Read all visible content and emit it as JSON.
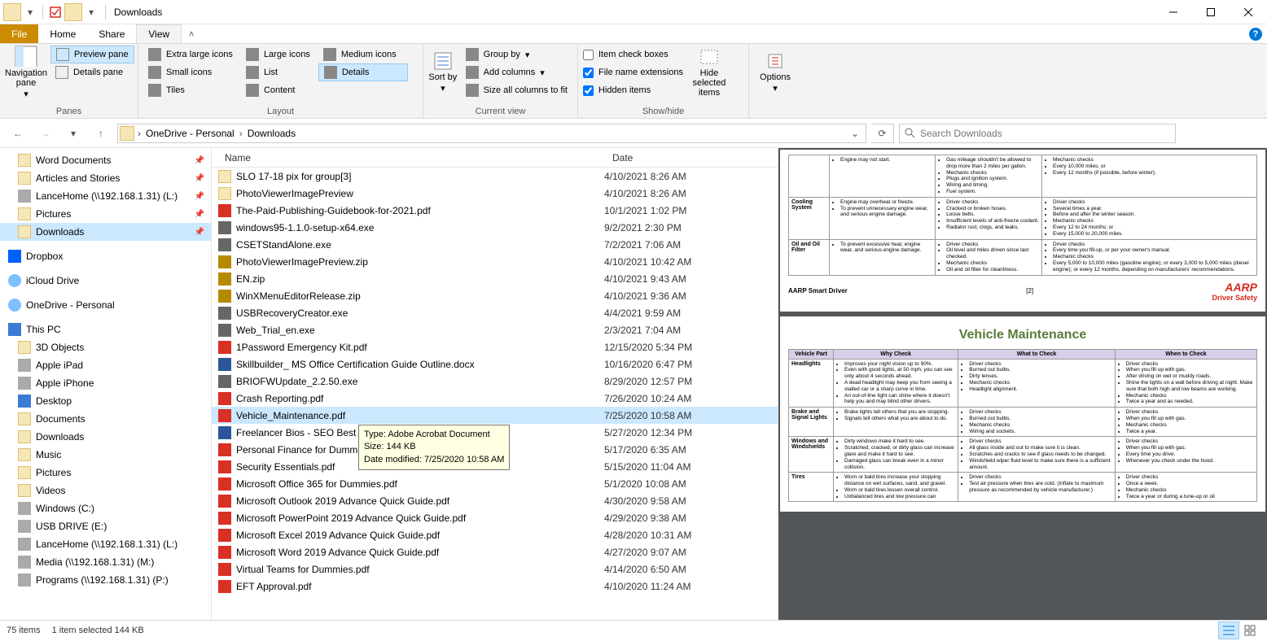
{
  "window": {
    "title": "Downloads"
  },
  "tabs": {
    "file": "File",
    "home": "Home",
    "share": "Share",
    "view": "View"
  },
  "ribbon": {
    "panes": {
      "label": "Panes",
      "nav": "Navigation pane",
      "preview": "Preview pane",
      "details": "Details pane"
    },
    "layout": {
      "label": "Layout",
      "xlarge": "Extra large icons",
      "large": "Large icons",
      "medium": "Medium icons",
      "small": "Small icons",
      "list": "List",
      "details": "Details",
      "tiles": "Tiles",
      "content": "Content"
    },
    "currentview": {
      "label": "Current view",
      "sortby": "Sort by",
      "groupby": "Group by",
      "addcols": "Add columns",
      "sizecols": "Size all columns to fit"
    },
    "showhide": {
      "label": "Show/hide",
      "itemcheck": "Item check boxes",
      "ext": "File name extensions",
      "hidden": "Hidden items",
      "hidesel": "Hide selected items"
    },
    "options": "Options"
  },
  "breadcrumb": {
    "seg1": "OneDrive - Personal",
    "seg2": "Downloads"
  },
  "search": {
    "placeholder": "Search Downloads"
  },
  "nav": {
    "items": [
      {
        "label": "Word Documents",
        "pin": true,
        "icon": "folder"
      },
      {
        "label": "Articles and Stories",
        "pin": true,
        "icon": "folder"
      },
      {
        "label": "LanceHome (\\\\192.168.1.31) (L:)",
        "pin": true,
        "icon": "disk"
      },
      {
        "label": "Pictures",
        "pin": true,
        "icon": "folder"
      },
      {
        "label": "Downloads",
        "pin": true,
        "icon": "folder",
        "selected": true
      },
      {
        "label": "",
        "spacer": true
      },
      {
        "label": "Dropbox",
        "icon": "dropbox",
        "section": true
      },
      {
        "label": "",
        "spacer": true
      },
      {
        "label": "iCloud Drive",
        "icon": "cloud",
        "section": true
      },
      {
        "label": "",
        "spacer": true
      },
      {
        "label": "OneDrive - Personal",
        "icon": "cloud",
        "section": true
      },
      {
        "label": "",
        "spacer": true
      },
      {
        "label": "This PC",
        "icon": "pc",
        "section": true
      },
      {
        "label": "3D Objects",
        "icon": "folder"
      },
      {
        "label": "Apple iPad",
        "icon": "disk"
      },
      {
        "label": "Apple iPhone",
        "icon": "disk"
      },
      {
        "label": "Desktop",
        "icon": "pc"
      },
      {
        "label": "Documents",
        "icon": "folder"
      },
      {
        "label": "Downloads",
        "icon": "folder"
      },
      {
        "label": "Music",
        "icon": "folder"
      },
      {
        "label": "Pictures",
        "icon": "folder"
      },
      {
        "label": "Videos",
        "icon": "folder"
      },
      {
        "label": "Windows (C:)",
        "icon": "disk"
      },
      {
        "label": "USB DRIVE (E:)",
        "icon": "disk"
      },
      {
        "label": "LanceHome (\\\\192.168.1.31) (L:)",
        "icon": "disk"
      },
      {
        "label": "Media (\\\\192.168.1.31) (M:)",
        "icon": "disk"
      },
      {
        "label": "Programs (\\\\192.168.1.31) (P:)",
        "icon": "disk"
      }
    ]
  },
  "columns": {
    "name": "Name",
    "date": "Date"
  },
  "files": [
    {
      "name": "SLO 17-18 pix for group[3]",
      "date": "4/10/2021 8:26 AM",
      "icon": "folder"
    },
    {
      "name": "PhotoViewerImagePreview",
      "date": "4/10/2021 8:26 AM",
      "icon": "folder"
    },
    {
      "name": "The-Paid-Publishing-Guidebook-for-2021.pdf",
      "date": "10/1/2021 1:02 PM",
      "icon": "pdf"
    },
    {
      "name": "windows95-1.1.0-setup-x64.exe",
      "date": "9/2/2021 2:30 PM",
      "icon": "exe"
    },
    {
      "name": "CSETStandAlone.exe",
      "date": "7/2/2021 7:06 AM",
      "icon": "exe"
    },
    {
      "name": "PhotoViewerImagePreview.zip",
      "date": "4/10/2021 10:42 AM",
      "icon": "zip"
    },
    {
      "name": "EN.zip",
      "date": "4/10/2021 9:43 AM",
      "icon": "zip"
    },
    {
      "name": "WinXMenuEditorRelease.zip",
      "date": "4/10/2021 9:36 AM",
      "icon": "zip"
    },
    {
      "name": "USBRecoveryCreator.exe",
      "date": "4/4/2021 9:59 AM",
      "icon": "exe"
    },
    {
      "name": "Web_Trial_en.exe",
      "date": "2/3/2021 7:04 AM",
      "icon": "exe"
    },
    {
      "name": "1Password Emergency Kit.pdf",
      "date": "12/15/2020 5:34 PM",
      "icon": "pdf"
    },
    {
      "name": "Skillbuilder_ MS Office Certification Guide Outline.docx",
      "date": "10/16/2020 6:47 PM",
      "icon": "doc"
    },
    {
      "name": "BRIOFWUpdate_2.2.50.exe",
      "date": "8/29/2020 12:57 PM",
      "icon": "exe"
    },
    {
      "name": "Crash Reporting.pdf",
      "date": "7/26/2020 10:24 AM",
      "icon": "pdf"
    },
    {
      "name": "Vehicle_Maintenance.pdf",
      "date": "7/25/2020 10:58 AM",
      "icon": "pdf",
      "selected": true
    },
    {
      "name": "Freelancer Bios - SEO Best Pr...",
      "date": "5/27/2020 12:34 PM",
      "icon": "doc"
    },
    {
      "name": "Personal Finance for Dummi...",
      "date": "5/17/2020 6:35 AM",
      "icon": "pdf"
    },
    {
      "name": "Security Essentials.pdf",
      "date": "5/15/2020 11:04 AM",
      "icon": "pdf"
    },
    {
      "name": "Microsoft Office 365 for Dummies.pdf",
      "date": "5/1/2020 10:08 AM",
      "icon": "pdf"
    },
    {
      "name": "Microsoft Outlook 2019 Advance Quick Guide.pdf",
      "date": "4/30/2020 9:58 AM",
      "icon": "pdf"
    },
    {
      "name": "Microsoft PowerPoint 2019 Advance Quick Guide.pdf",
      "date": "4/29/2020 9:38 AM",
      "icon": "pdf"
    },
    {
      "name": "Microsoft Excel 2019 Advance Quick Guide.pdf",
      "date": "4/28/2020 10:31 AM",
      "icon": "pdf"
    },
    {
      "name": "Microsoft Word 2019 Advance Quick Guide.pdf",
      "date": "4/27/2020 9:07 AM",
      "icon": "pdf"
    },
    {
      "name": "Virtual Teams for Dummies.pdf",
      "date": "4/14/2020 6:50 AM",
      "icon": "pdf"
    },
    {
      "name": "EFT Approval.pdf",
      "date": "4/10/2020 11:24 AM",
      "icon": "pdf"
    }
  ],
  "tooltip": {
    "line1": "Type: Adobe Acrobat Document",
    "line2": "Size: 144 KB",
    "line3": "Date modified: 7/25/2020 10:58 AM"
  },
  "status": {
    "items": "75 items",
    "selected": "1 item selected  144 KB"
  },
  "preview": {
    "page1_partial_rows": [
      {
        "part": "",
        "why": [
          "Engine may not start."
        ],
        "what": [
          "Gas mileage shouldn't be allowed to drop more than 2 miles per gallon.",
          "Mechanic checks",
          "Plugs and ignition system.",
          "Wiring and timing.",
          "Fuel system."
        ],
        "when": [
          "Mechanic checks",
          "Every 10,000 miles, or",
          "Every 12 months (if possible, before winter)."
        ]
      },
      {
        "part": "Cooling System",
        "why": [
          "Engine may overheat or freeze.",
          "To prevent unnecessary engine wear, and serious engine damage."
        ],
        "what": [
          "Driver checks",
          "Cracked or broken hoses.",
          "Loose belts.",
          "Insufficient levels of anti-freeze coolant.",
          "Radiator rust, clogs, and leaks."
        ],
        "when": [
          "Driver checks",
          "Several times a year.",
          "Before and after the winter season.",
          "Mechanic checks",
          "Every 12 to 24 months; or",
          "Every 15,000 to 20,000 miles."
        ]
      },
      {
        "part": "Oil and Oil Filter",
        "why": [
          "To prevent excessive heat, engine wear, and serious engine damage."
        ],
        "what": [
          "Driver checks",
          "Oil level and miles driven since last checked.",
          "Mechanic checks",
          "Oil and oil filter for cleanliness."
        ],
        "when": [
          "Driver checks",
          "Every time you fill-up, or per your owner's manual.",
          "Mechanic checks",
          "Every 5,000 to 10,000 miles (gasoline engine); or every 3,000 to 5,000 miles (diesel engine); or every 12 months, depending on manufacturers' recommendations."
        ]
      }
    ],
    "footer_left": "AARP Smart Driver",
    "footer_page": "[2]",
    "aarp": "AARP",
    "aarp_sub": "Driver Safety",
    "page2_title": "Vehicle Maintenance",
    "page2_headers": {
      "part": "Vehicle Part",
      "why": "Why Check",
      "what": "What to Check",
      "when": "When to Check"
    },
    "page2_rows": [
      {
        "part": "Headlights",
        "why": [
          "Improves your night vision up to 90%.",
          "Even with good lights, at 50 mph, you can see only about 4 seconds ahead.",
          "A dead headlight may keep you from seeing a stalled car or a sharp curve in time.",
          "An out-of-line light can shine where it doesn't help you and may blind other drivers."
        ],
        "what": [
          "Driver checks",
          "Burned out bulbs.",
          "Dirty lenses.",
          "Mechanic checks",
          "Headlight alignment."
        ],
        "when": [
          "Driver checks",
          "When you fill up with gas.",
          "After driving on wet or muddy roads.",
          "Shine the lights on a wall before driving at night. Make sure that both high and low beams are working.",
          "Mechanic checks",
          "Twice a year and as needed."
        ]
      },
      {
        "part": "Brake and Signal Lights",
        "why": [
          "Brake lights tell others that you are stopping.",
          "Signals tell others what you are about to do."
        ],
        "what": [
          "Driver checks",
          "Burned out bulbs.",
          "Mechanic checks",
          "Wiring and sockets."
        ],
        "when": [
          "Driver checks",
          "When you fill up with gas.",
          "Mechanic checks",
          "Twice a year."
        ]
      },
      {
        "part": "Windows and Windshields",
        "why": [
          "Dirty windows make it hard to see.",
          "Scratched, cracked, or dirty glass can increase glare and make it hard to see.",
          "Damaged glass can break even in a minor collision."
        ],
        "what": [
          "Driver checks",
          "All glass inside and out to make sure it is clean.",
          "Scratches and cracks to see if glass needs to be changed.",
          "Windshield wiper fluid level to make sure there is a sufficient amount."
        ],
        "when": [
          "Driver checks",
          "When you fill up with gas.",
          "Every time you drive.",
          "Whenever you check under the hood."
        ]
      },
      {
        "part": "Tires",
        "why": [
          "Worn or bald tires increase your stopping distance on wet surfaces, sand, and gravel.",
          "Worn or bald tires lessen overall control.",
          "Unbalanced tires and low pressure can"
        ],
        "what": [
          "Driver checks",
          "Test air pressure when tires are cold. (Inflate to maximum pressure as recommended by vehicle manufacturer.)"
        ],
        "when": [
          "Driver checks",
          "Once a week.",
          "Mechanic checks",
          "Twice a year or during a tune-up or oil"
        ]
      }
    ]
  }
}
